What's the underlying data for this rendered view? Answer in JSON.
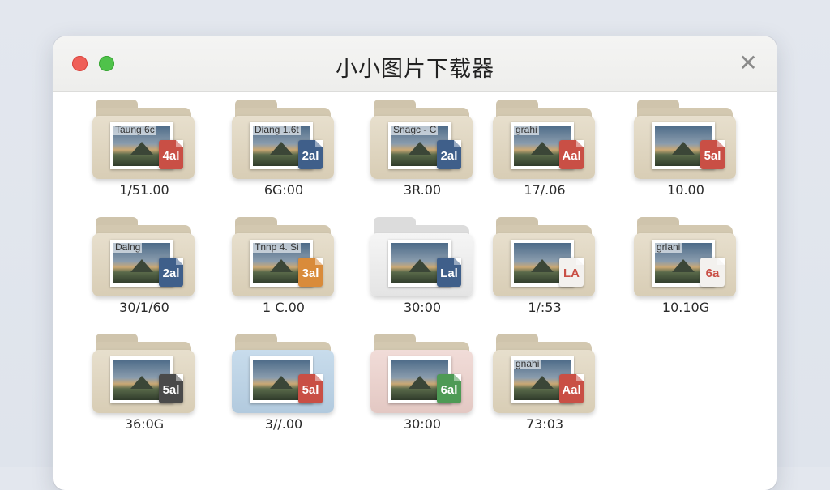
{
  "window": {
    "title": "小小图片下载器",
    "close_glyph": "✕"
  },
  "items": [
    {
      "label": "Taung 6c",
      "badge": "4al",
      "badge_color": "#c94f45",
      "size": "1/51.00",
      "folder": "tan"
    },
    {
      "label": "Diang 1.6t",
      "badge": "2al",
      "badge_color": "#3f5f8a",
      "size": "6G:00",
      "folder": "tan"
    },
    {
      "label": "Snagc - C",
      "badge": "2al",
      "badge_color": "#3f5f8a",
      "size": "3R.00",
      "folder": "tan"
    },
    {
      "label": "grahi",
      "badge": "Aal",
      "badge_color": "#c94f45",
      "size": "17/.06",
      "folder": "tan"
    },
    {
      "label": "",
      "badge": "5al",
      "badge_color": "#c94f45",
      "size": "10.00",
      "folder": "tan"
    },
    {
      "label": "Dalng",
      "badge": "2al",
      "badge_color": "#3f5f8a",
      "size": "30/1/60",
      "folder": "tan"
    },
    {
      "label": "Tnnp 4. Si",
      "badge": "3al",
      "badge_color": "#d98b3a",
      "size": "1 C.00",
      "folder": "tan"
    },
    {
      "label": "",
      "badge": "Lal",
      "badge_color": "#3f5f8a",
      "size": "30:00",
      "folder": "white"
    },
    {
      "label": "",
      "badge": "LA",
      "badge_color": "#f3f1ee",
      "size": "1/:53",
      "folder": "tan"
    },
    {
      "label": "grlani",
      "badge": "6a",
      "badge_color": "#f3f1ee",
      "size": "10.10G",
      "folder": "tan"
    },
    {
      "label": "",
      "badge": "5al",
      "badge_color": "#4a4a4a",
      "size": "36:0G",
      "folder": "tan"
    },
    {
      "label": "",
      "badge": "5al",
      "badge_color": "#c94f45",
      "size": "3//.00",
      "folder": "blue"
    },
    {
      "label": "",
      "badge": "6al",
      "badge_color": "#4e9a55",
      "size": "30:00",
      "folder": "pink"
    },
    {
      "label": "gnahi",
      "badge": "Aal",
      "badge_color": "#c94f45",
      "size": "73:03",
      "folder": "tan"
    }
  ]
}
